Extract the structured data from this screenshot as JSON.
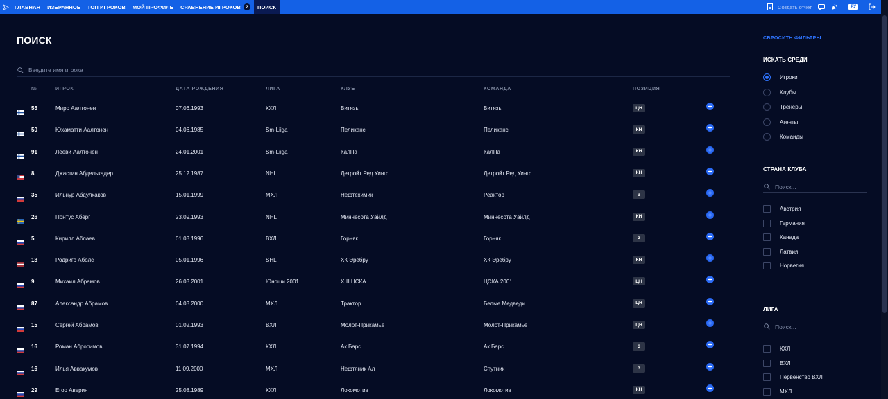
{
  "nav": {
    "items": [
      {
        "label": "ГЛАВНАЯ"
      },
      {
        "label": "ИЗБРАННОЕ"
      },
      {
        "label": "ТОП ИГРОКОВ"
      },
      {
        "label": "МОЙ ПРОФИЛЬ"
      },
      {
        "label": "СРАВНЕНИЕ ИГРОКОВ",
        "badge": "2"
      },
      {
        "label": "ПОИСК",
        "active": true
      }
    ],
    "create_report": "Создать отчет",
    "lang": "РУ"
  },
  "page": {
    "title": "ПОИСК",
    "search_placeholder": "Введите имя игрока"
  },
  "table": {
    "headers": {
      "number": "№",
      "player": "ИГРОК",
      "birth": "ДАТА РОЖДЕНИЯ",
      "league": "ЛИГА",
      "club": "КЛУБ",
      "team": "КОМАНДА",
      "position": "ПОЗИЦИЯ"
    },
    "rows": [
      {
        "flag": "FI",
        "number": "55",
        "name": "Миро Аалтонен",
        "birth": "07.06.1993",
        "league": "КХЛ",
        "club": "Витязь",
        "team": "Витязь",
        "position": "ЦН"
      },
      {
        "flag": "FI",
        "number": "50",
        "name": "Юхаматти Аалтонен",
        "birth": "04.06.1985",
        "league": "Sm-Liiga",
        "club": "Пеликанс",
        "team": "Пеликанс",
        "position": "КН"
      },
      {
        "flag": "FI",
        "number": "91",
        "name": "Лееви Аалтонен",
        "birth": "24.01.2001",
        "league": "Sm-Liiga",
        "club": "КалПа",
        "team": "КалПа",
        "position": "КН"
      },
      {
        "flag": "US",
        "number": "8",
        "name": "Джастин Абделькадер",
        "birth": "25.12.1987",
        "league": "NHL",
        "club": "Детройт Ред Уингс",
        "team": "Детройт Ред Уингс",
        "position": "КН"
      },
      {
        "flag": "RU",
        "number": "35",
        "name": "Ильнур Абдулхаков",
        "birth": "15.01.1999",
        "league": "МХЛ",
        "club": "Нефтехимик",
        "team": "Реактор",
        "position": "В"
      },
      {
        "flag": "SE",
        "number": "26",
        "name": "Понтус Аберг",
        "birth": "23.09.1993",
        "league": "NHL",
        "club": "Миннесота Уайлд",
        "team": "Миннесота Уайлд",
        "position": "КН"
      },
      {
        "flag": "RU",
        "number": "5",
        "name": "Кирилл Аблаев",
        "birth": "01.03.1996",
        "league": "ВХЛ",
        "club": "Горняк",
        "team": "Горняк",
        "position": "З"
      },
      {
        "flag": "LV",
        "number": "18",
        "name": "Родриго Аболс",
        "birth": "05.01.1996",
        "league": "SHL",
        "club": "ХК Эребру",
        "team": "ХК Эребру",
        "position": "КН"
      },
      {
        "flag": "RU",
        "number": "9",
        "name": "Михаил Абрамов",
        "birth": "26.03.2001",
        "league": "Юноши 2001",
        "club": "ХШ ЦСКА",
        "team": "ЦСКА 2001",
        "position": "ЦН"
      },
      {
        "flag": "RU",
        "number": "87",
        "name": "Александр Абрамов",
        "birth": "04.03.2000",
        "league": "МХЛ",
        "club": "Трактор",
        "team": "Белые Медведи",
        "position": "ЦН"
      },
      {
        "flag": "RU",
        "number": "15",
        "name": "Сергей Абрамов",
        "birth": "01.02.1993",
        "league": "ВХЛ",
        "club": "Молот-Прикамье",
        "team": "Молот-Прикамье",
        "position": "ЦН"
      },
      {
        "flag": "RU",
        "number": "16",
        "name": "Роман Абросимов",
        "birth": "31.07.1994",
        "league": "КХЛ",
        "club": "Ак Барс",
        "team": "Ак Барс",
        "position": "З"
      },
      {
        "flag": "RU",
        "number": "16",
        "name": "Илья Аввакумов",
        "birth": "11.09.2000",
        "league": "МХЛ",
        "club": "Нефтяник Ал",
        "team": "Спутник",
        "position": "З"
      },
      {
        "flag": "RU",
        "number": "29",
        "name": "Егор Аверин",
        "birth": "25.08.1989",
        "league": "КХЛ",
        "club": "Локомотив",
        "team": "Локомотив",
        "position": "КН"
      }
    ]
  },
  "sidebar": {
    "reset": "СБРОСИТЬ ФИЛЬТРЫ",
    "search_among": {
      "title": "ИСКАТЬ СРЕДИ",
      "options": [
        {
          "label": "Игроки",
          "selected": true
        },
        {
          "label": "Клубы",
          "selected": false
        },
        {
          "label": "Тренеры",
          "selected": false
        },
        {
          "label": "Агенты",
          "selected": false
        },
        {
          "label": "Команды",
          "selected": false
        }
      ]
    },
    "club_country": {
      "title": "СТРАНА КЛУБА",
      "placeholder": "Поиск...",
      "options": [
        "Австрия",
        "Германия",
        "Канада",
        "Латвия",
        "Норвегия"
      ]
    },
    "league": {
      "title": "ЛИГА",
      "placeholder": "Поиск...",
      "options": [
        "КХЛ",
        "ВХЛ",
        "Первенство ВХЛ",
        "МХЛ"
      ]
    }
  },
  "colors": {
    "accent": "#1461e6",
    "background": "#050c24",
    "plus_button": "#2a6af5"
  }
}
